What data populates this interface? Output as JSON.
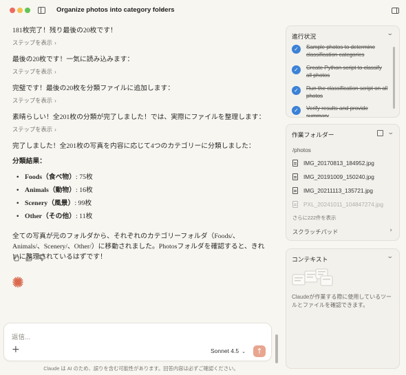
{
  "window": {
    "conversation_title": "Organize photos into category folders"
  },
  "chat": {
    "messages": [
      {
        "text": "181枚完了！残り最後の20枚です！",
        "steps_label": "ステップを表示"
      },
      {
        "text": "最後の20枚です！一気に読み込みます：",
        "steps_label": "ステップを表示"
      },
      {
        "text": "完璧です！最後の20枚を分類ファイルに追加します：",
        "steps_label": "ステップを表示"
      },
      {
        "text": "素晴らしい！全201枚の分類が完了しました！では、実際にファイルを整理します：",
        "steps_label": "ステップを表示"
      }
    ],
    "final": {
      "intro": "完了しました！全201枚の写真を内容に応じて4つのカテゴリーに分類しました：",
      "results_heading": "分類結果：",
      "results": [
        {
          "category": "Foods（食べ物）",
          "count": ": 75枚"
        },
        {
          "category": "Animals（動物）",
          "count": ": 16枚"
        },
        {
          "category": "Scenery（風景）",
          "count": ": 99枚"
        },
        {
          "category": "Other（その他）",
          "count": ": 11枚"
        }
      ],
      "summary": "全ての写真が元のフォルダから、それぞれのカテゴリーフォルダ（Foods/、Animals/、Scenery/、Other/）に移動されました。Photosフォルダを確認すると、きれいに整理されているはずです！"
    }
  },
  "composer": {
    "placeholder": "返信...",
    "model": "Sonnet 4.5",
    "disclaimer": "Claude は AI のため、誤りを含む可能性があります。回答内容は必ずご確認ください。"
  },
  "progress": {
    "title": "進行状況",
    "tasks": [
      "Sample photos to determine classification categories",
      "Create Python script to classify all photos",
      "Run the classification script on all photos",
      "Verify results and provide summary"
    ]
  },
  "working_folder": {
    "title": "作業フォルダー",
    "path": "/photos",
    "files": [
      "IMG_20170813_184952.jpg",
      "IMG_20191009_150240.jpg",
      "IMG_20211113_135721.jpg",
      "PXL_20241011_104847274.jpg"
    ],
    "more_label": "さらに222件を表示",
    "scratchpad_label": "スクラッチパッド"
  },
  "context": {
    "title": "コンテキスト",
    "description": "Claudeが作業する際に使用しているツールとファイルを確認できます。"
  },
  "colors": {
    "accent_check": "#3b82d6",
    "send_button": "#e8a58f",
    "claude_logo": "#d9694f"
  }
}
